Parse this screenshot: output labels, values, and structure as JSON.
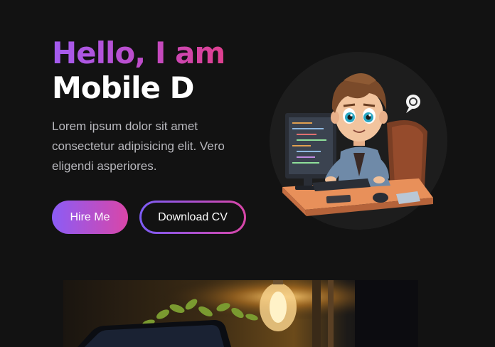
{
  "hero": {
    "title_line1": "Hello, I am",
    "title_line2": "Mobile D",
    "description": "Lorem ipsum dolor sit amet consectetur adipisicing elit. Vero eligendi asperiores."
  },
  "buttons": {
    "hire": "Hire Me",
    "download": "Download CV"
  },
  "colors": {
    "background": "#121212",
    "accent_start": "#8b5cf6",
    "accent_end": "#d946a8"
  },
  "images": {
    "avatar": "developer-avatar-illustration",
    "bottom": "desk-lamp-plant-photo"
  }
}
